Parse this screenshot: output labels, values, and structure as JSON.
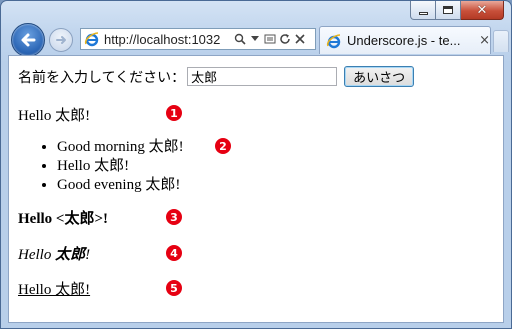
{
  "browser": {
    "url": "http://localhost:1032",
    "tab_title": "Underscore.js - te...",
    "tab_close": "×"
  },
  "page": {
    "form": {
      "label": "名前を入力してください：",
      "input_value": "太郎",
      "button_label": "あいさつ"
    },
    "line1": "Hello 太郎!",
    "list": [
      "Good morning 太郎!",
      "Hello 太郎!",
      "Good evening 太郎!"
    ],
    "line3_prefix": "Hello <",
    "line3_name": "太郎",
    "line3_suffix": ">!",
    "line4_prefix": "Hello ",
    "line4_name": "太郎",
    "line4_suffix": "!",
    "line5": "Hello 太郎!"
  },
  "badges": [
    "1",
    "2",
    "3",
    "4",
    "5"
  ],
  "colors": {
    "badge": "#e60012",
    "window_frame": "#c2d6ee"
  }
}
